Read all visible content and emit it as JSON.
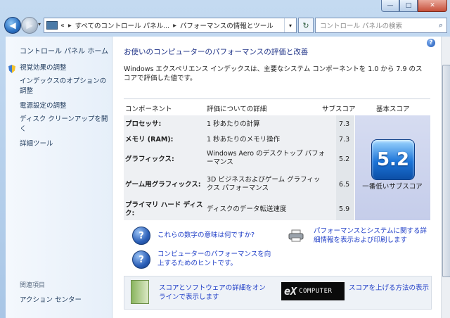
{
  "window": {
    "min_glyph": "—",
    "max_glyph": "□",
    "close_glyph": "✕"
  },
  "nav": {
    "back_glyph": "◀",
    "fwd_glyph": "▶",
    "address_lead": "«",
    "address_part1": "すべてのコントロール パネル...",
    "address_part2": "パフォーマンスの情報とツール",
    "sep": "▸",
    "refresh_glyph": "↻",
    "search_placeholder": "コントロール パネルの検索"
  },
  "sidebar": {
    "home": "コントロール パネル ホーム",
    "items": [
      {
        "label": "視覚効果の調整"
      },
      {
        "label": "インデックスのオプションの調整"
      },
      {
        "label": "電源設定の調整"
      },
      {
        "label": "ディスク クリーンアップを開く"
      },
      {
        "label": "詳細ツール"
      }
    ],
    "related_title": "関連項目",
    "related_items": [
      {
        "label": "アクション センター"
      }
    ]
  },
  "main": {
    "heading": "お使いのコンピューターのパフォーマンスの評価と改善",
    "intro": "Windows エクスペリエンス インデックスは、主要なシステム コンポーネントを 1.0 から 7.9 のスコアで評価した値です。",
    "table": {
      "headers": {
        "component": "コンポーネント",
        "detail": "評価についての詳細",
        "subscore": "サブスコア",
        "basescore": "基本スコア"
      },
      "rows": [
        {
          "component": "プロセッサ:",
          "detail": "1 秒あたりの計算",
          "subscore": "7.3"
        },
        {
          "component": "メモリ (RAM):",
          "detail": "1 秒あたりのメモリ操作",
          "subscore": "7.3"
        },
        {
          "component": "グラフィックス:",
          "detail": "Windows Aero のデスクトップ パフォーマンス",
          "subscore": "5.2"
        },
        {
          "component": "ゲーム用グラフィックス:",
          "detail": "3D ビジネスおよびゲーム グラフィックス パフォーマンス",
          "subscore": "6.5"
        },
        {
          "component": "プライマリ ハード ディスク:",
          "detail": "ディスクのデータ転送速度",
          "subscore": "5.9"
        }
      ],
      "base_score": "5.2",
      "base_label": "一番低いサブスコア"
    },
    "links": {
      "meaning": "これらの数字の意味は何ですか?",
      "tips": "コンピューターのパフォーマンスを向上するためのヒントです。",
      "print": "パフォーマンスとシステムに関する詳細情報を表示および印刷します"
    },
    "bottom": {
      "online": "スコアとソフトウェアの詳細をオンラインで表示します",
      "raise": "スコアを上げる方法の表示",
      "logo_ex": "eX",
      "logo_computer": "COMPUTER"
    },
    "help_glyph": "?",
    "question_glyph": "?"
  }
}
